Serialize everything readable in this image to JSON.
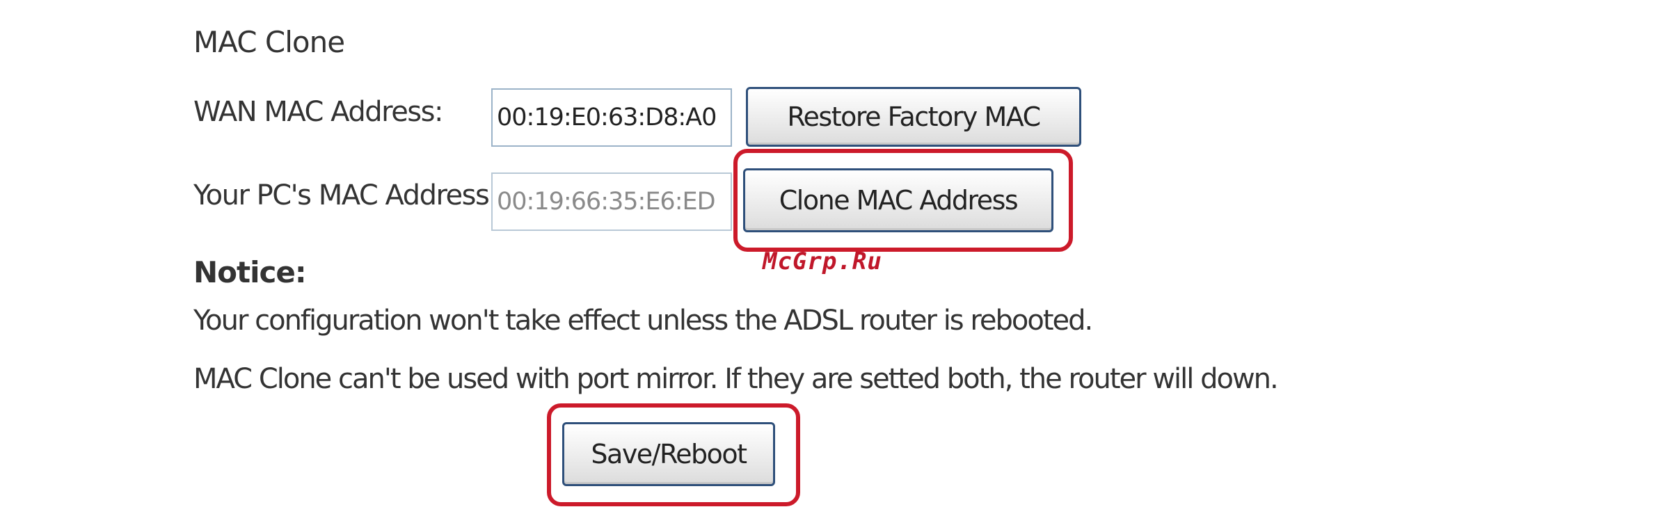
{
  "section": {
    "title": "MAC Clone"
  },
  "wan_mac": {
    "label": "WAN MAC Address:",
    "value": "00:19:E0:63:D8:A0",
    "restore_button_label": "Restore Factory MAC"
  },
  "pc_mac": {
    "label": "Your PC's MAC Address:",
    "value": "00:19:66:35:E6:ED",
    "clone_button_label": "Clone MAC Address"
  },
  "watermark": "McGrp.Ru",
  "notice": {
    "title": "Notice:",
    "lines": [
      "Your configuration won't take effect unless the ADSL router is rebooted.",
      "MAC Clone can't be used with port mirror. If they are setted both, the router will down."
    ]
  },
  "actions": {
    "save_reboot_label": "Save/Reboot"
  },
  "colors": {
    "highlight": "#cc1a2a",
    "button_border": "#2e4f7a",
    "text": "#333333"
  }
}
